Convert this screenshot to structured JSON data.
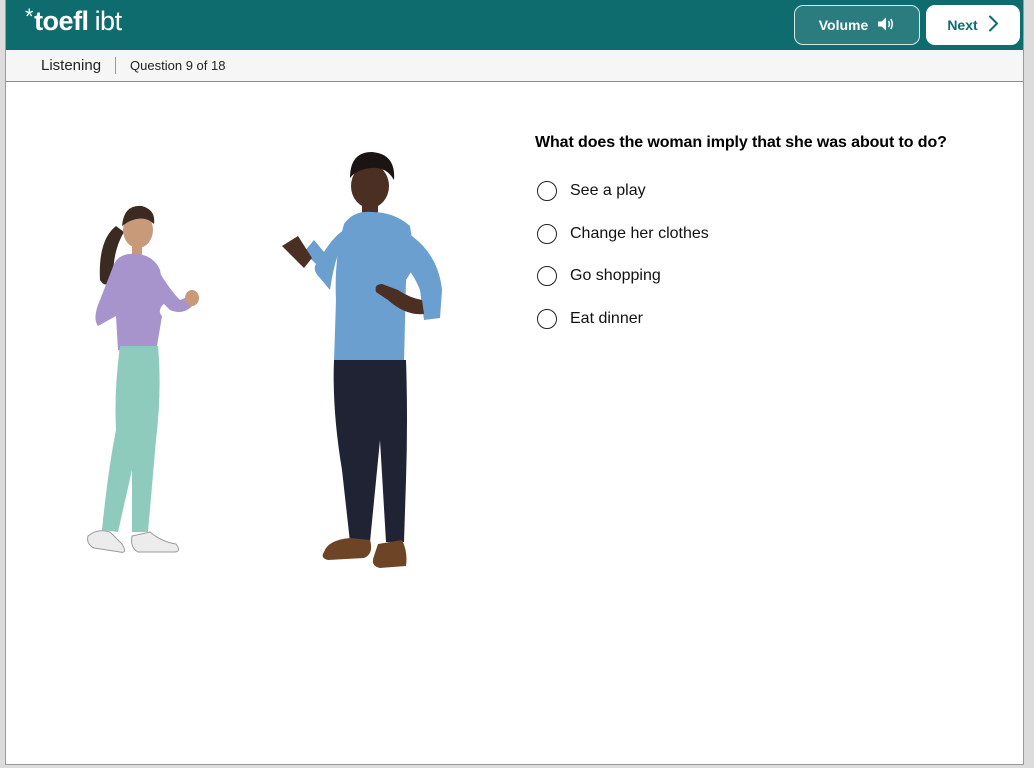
{
  "header": {
    "logo_star": "*",
    "logo_word1": "toefl",
    "logo_word2": "ibt",
    "volume_label": "Volume",
    "volume_icon": "speaker-icon",
    "next_label": "Next",
    "next_icon": "chevron-right-icon",
    "brand_color": "#0e6b6e"
  },
  "subheader": {
    "section": "Listening",
    "question_counter": "Question 9 of 18"
  },
  "question": {
    "prompt": "What does the woman imply that she was about to do?",
    "options": [
      {
        "label": "See a play"
      },
      {
        "label": "Change her clothes"
      },
      {
        "label": "Go shopping"
      },
      {
        "label": "Eat dinner"
      }
    ]
  },
  "illustration": {
    "description_icon": "conversation-illustration"
  }
}
